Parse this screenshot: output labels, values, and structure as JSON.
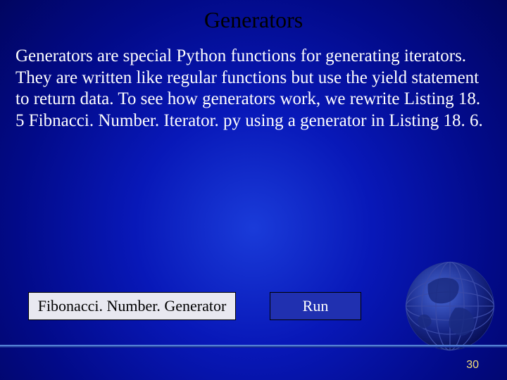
{
  "title": "Generators",
  "body": "Generators are special Python functions for generating iterators. They are written like regular functions but use the yield statement to return data. To see how generators work, we rewrite Listing 18. 5 Fibnacci. Number. Iterator. py using a generator in Listing 18. 6.",
  "buttons": {
    "code": "Fibonacci. Number. Generator",
    "run": "Run"
  },
  "page_number": "30"
}
